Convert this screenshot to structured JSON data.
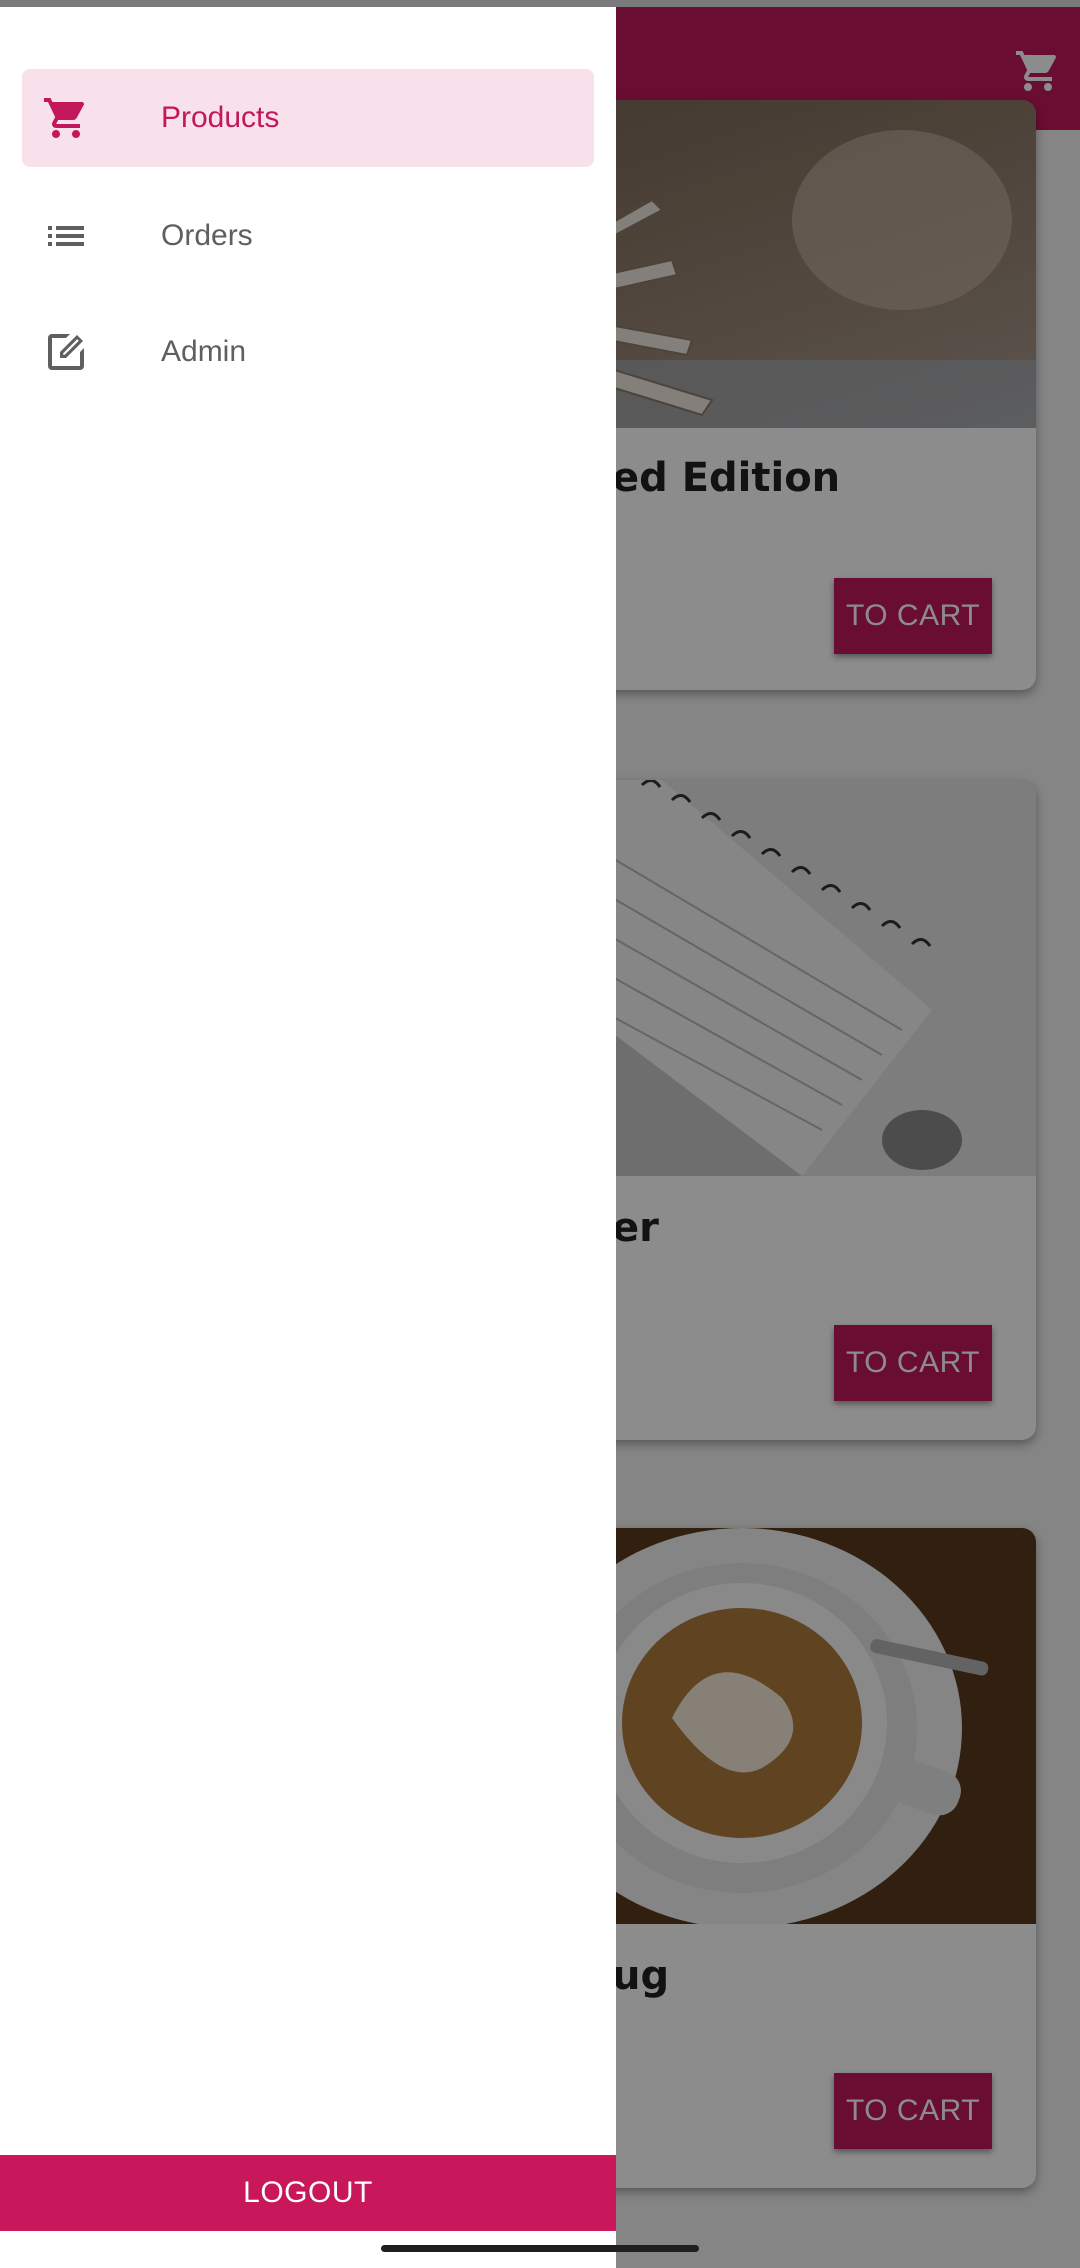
{
  "colors": {
    "primary": "#c2185b",
    "active_item_bg": "#f8e1ea",
    "drawer_text": "#5f5f5f"
  },
  "appbar": {
    "cart_icon": "cart-icon"
  },
  "drawer": {
    "items": [
      {
        "label": "Products",
        "icon": "cart-icon",
        "active": true
      },
      {
        "label": "Orders",
        "icon": "list-icon",
        "active": false
      },
      {
        "label": "Admin",
        "icon": "edit-icon",
        "active": false
      }
    ],
    "logout_label": "LOGOUT"
  },
  "products": [
    {
      "title_visible": "ed Edition",
      "button_label": "TO CART"
    },
    {
      "title_visible": "er",
      "button_label": "TO CART"
    },
    {
      "title_visible": "ug",
      "button_label": "TO CART"
    }
  ]
}
